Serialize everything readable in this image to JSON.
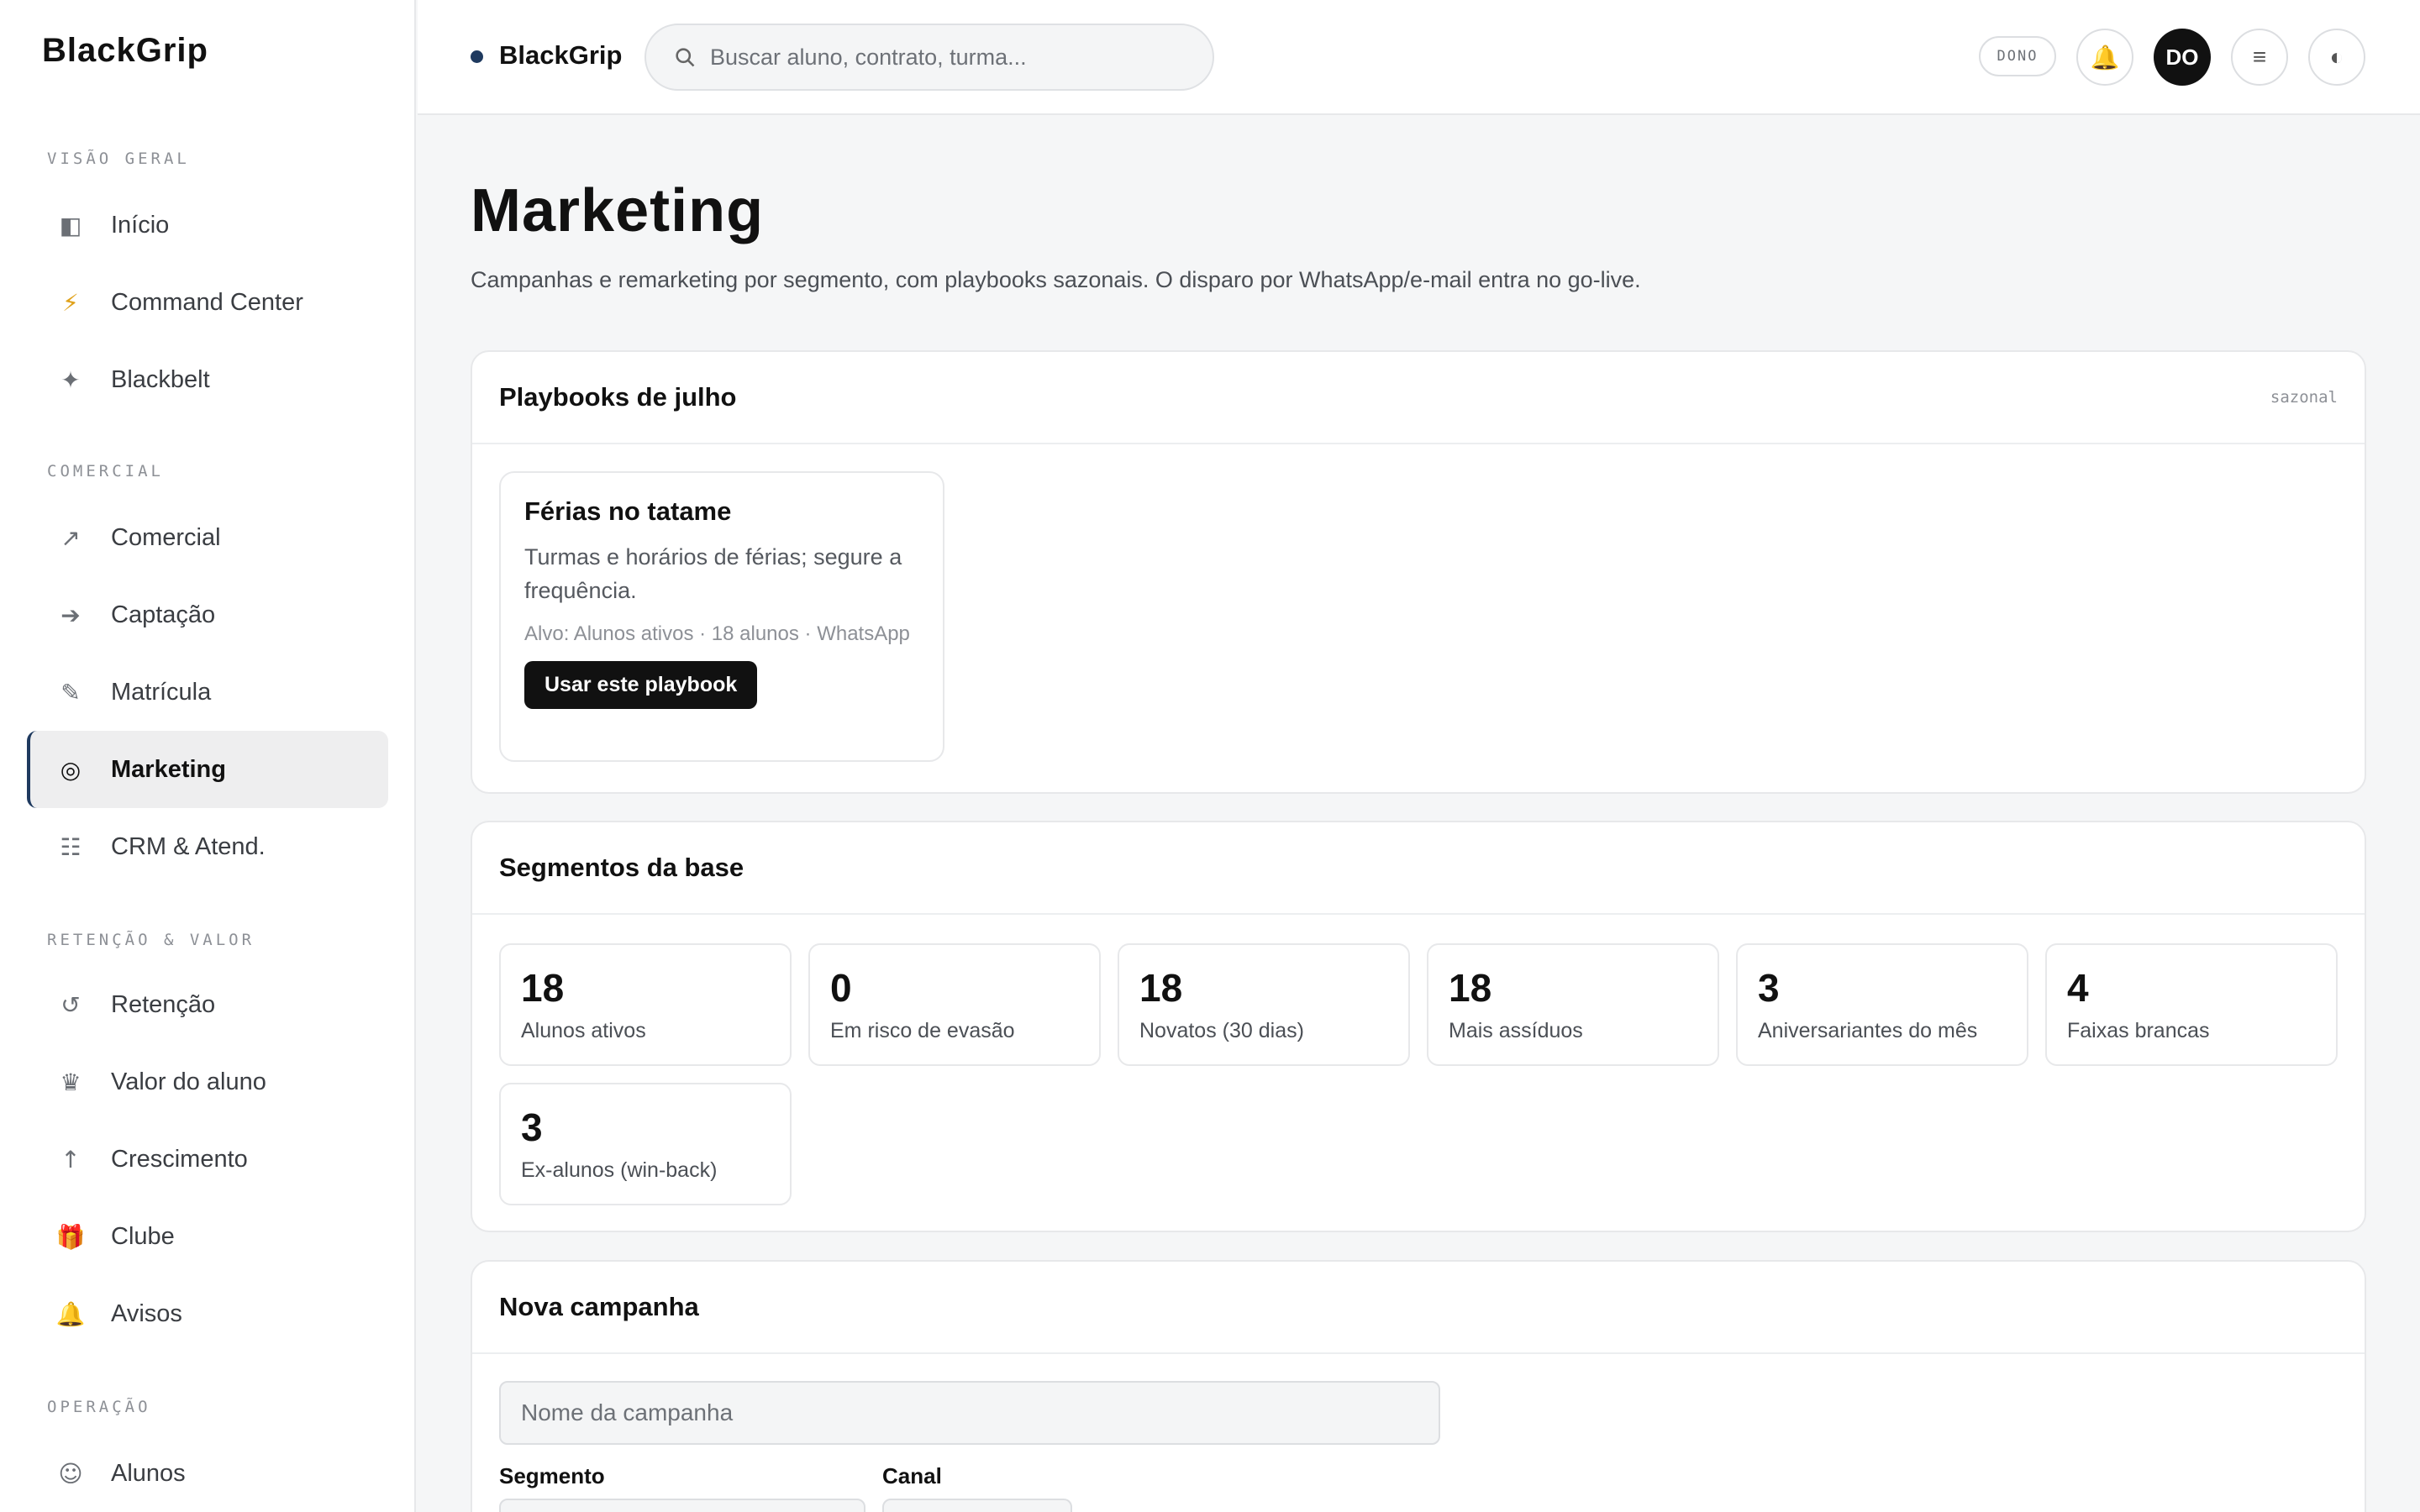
{
  "app": {
    "logo": "BlackGrip"
  },
  "sidebar": {
    "sections": [
      {
        "label": "VISÃO GERAL"
      },
      {
        "label": "COMERCIAL"
      },
      {
        "label": "RETENÇÃO & VALOR"
      },
      {
        "label": "OPERAÇÃO"
      }
    ],
    "items": [
      {
        "label": "Início",
        "icon": "◧",
        "icon_name": "home-icon"
      },
      {
        "label": "Command Center",
        "icon": "⚡",
        "icon_name": "lightning-icon"
      },
      {
        "label": "Blackbelt",
        "icon": "✦",
        "icon_name": "sparkle-icon"
      },
      {
        "label": "Comercial",
        "icon": "↗",
        "icon_name": "trend-icon"
      },
      {
        "label": "Captação",
        "icon": "➔",
        "icon_name": "arrow-right-icon"
      },
      {
        "label": "Matrícula",
        "icon": "✎",
        "icon_name": "pencil-icon"
      },
      {
        "label": "Marketing",
        "icon": "◎",
        "icon_name": "target-icon"
      },
      {
        "label": "CRM & Atend.",
        "icon": "☷",
        "icon_name": "list-icon"
      },
      {
        "label": "Retenção",
        "icon": "↺",
        "icon_name": "refresh-icon"
      },
      {
        "label": "Valor do aluno",
        "icon": "♛",
        "icon_name": "crown-icon"
      },
      {
        "label": "Crescimento",
        "icon": "↑",
        "icon_name": "arrow-up-icon"
      },
      {
        "label": "Clube",
        "icon": "🎁",
        "icon_name": "gift-icon"
      },
      {
        "label": "Avisos",
        "icon": "🔔",
        "icon_name": "bell-icon"
      },
      {
        "label": "Alunos",
        "icon": "☺",
        "icon_name": "smiley-icon"
      }
    ],
    "active_item": "Marketing"
  },
  "topbar": {
    "brand": "BlackGrip",
    "search_placeholder": "Buscar aluno, contrato, turma...",
    "role_badge": "DONO",
    "bell_icon": "🔔",
    "avatar_initials": "DO",
    "menu_icon": "≡",
    "theme_icon": "◐"
  },
  "page": {
    "title": "Marketing",
    "subtitle": "Campanhas e remarketing por segmento, com playbooks sazonais. O disparo por WhatsApp/e-mail entra no go-live."
  },
  "playbooks": {
    "title": "Playbooks de julho",
    "tag": "sazonal",
    "items": [
      {
        "title": "Férias no tatame",
        "description": "Turmas e horários de férias; segure a frequência.",
        "meta": "Alvo: Alunos ativos · 18 alunos · WhatsApp",
        "button": "Usar este playbook"
      }
    ]
  },
  "segments": {
    "title": "Segmentos da base",
    "items": [
      {
        "value": "18",
        "label": "Alunos ativos"
      },
      {
        "value": "0",
        "label": "Em risco de evasão"
      },
      {
        "value": "18",
        "label": "Novatos (30 dias)"
      },
      {
        "value": "18",
        "label": "Mais assíduos"
      },
      {
        "value": "3",
        "label": "Aniversariantes do mês"
      },
      {
        "value": "4",
        "label": "Faixas brancas"
      },
      {
        "value": "3",
        "label": "Ex-alunos (win-back)"
      }
    ]
  },
  "new_campaign": {
    "title": "Nova campanha",
    "name_placeholder": "Nome da campanha",
    "segment_label": "Segmento",
    "channel_label": "Canal"
  },
  "colors": {
    "accent": "#1f3a5f",
    "button": "#111111"
  }
}
